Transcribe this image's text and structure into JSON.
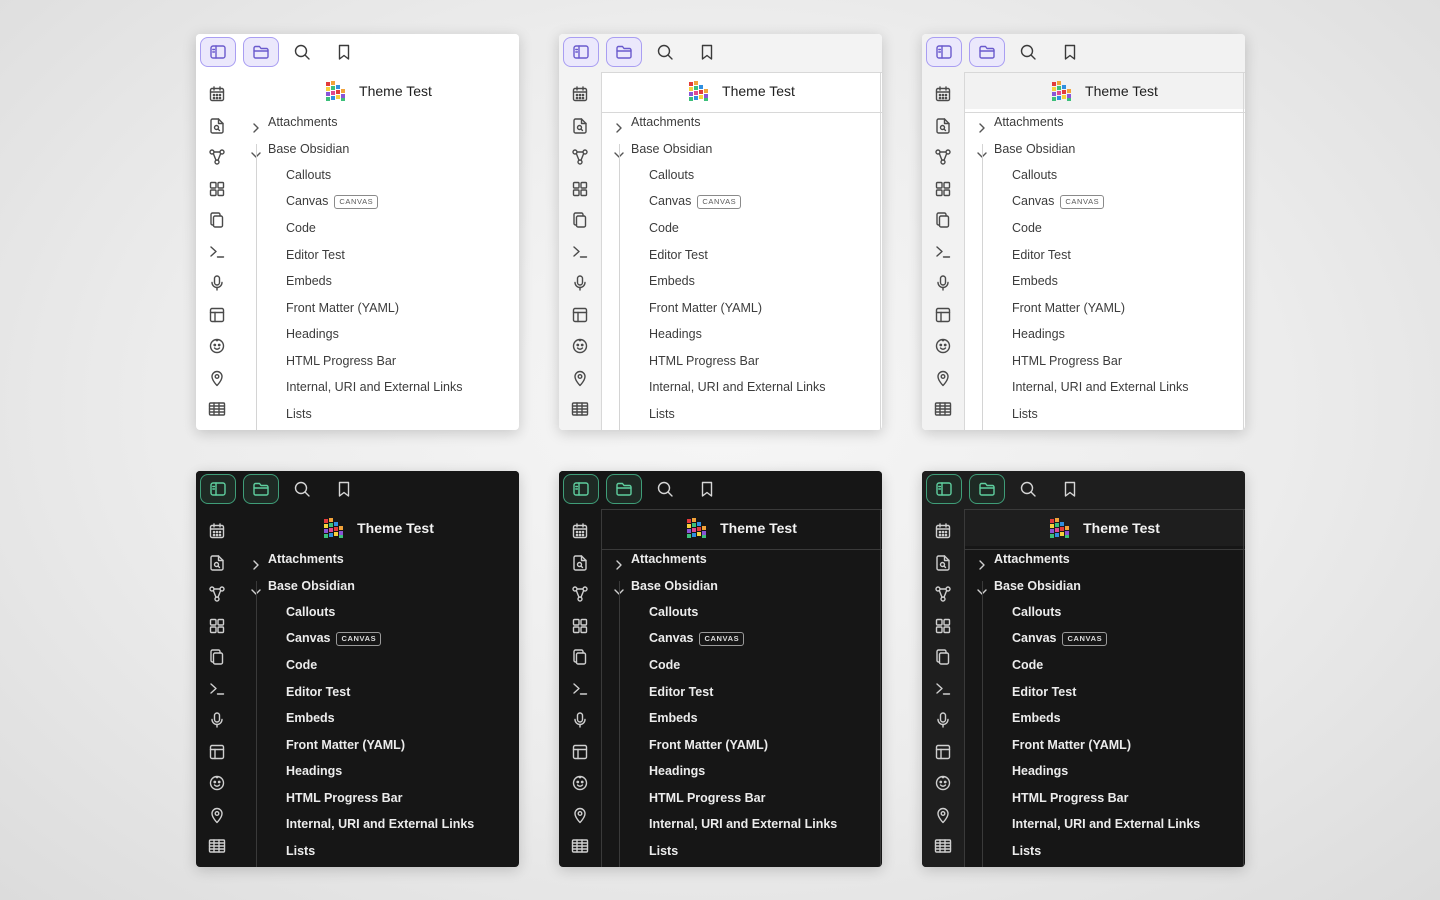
{
  "vault": {
    "name": "Theme Test"
  },
  "tree": {
    "folders": [
      {
        "label": "Attachments",
        "expanded": false
      },
      {
        "label": "Base Obsidian",
        "expanded": true
      }
    ],
    "files": [
      {
        "label": "Callouts",
        "badge": ""
      },
      {
        "label": "Canvas",
        "badge": "CANVAS"
      },
      {
        "label": "Code",
        "badge": ""
      },
      {
        "label": "Editor Test",
        "badge": ""
      },
      {
        "label": "Embeds",
        "badge": ""
      },
      {
        "label": "Front Matter (YAML)",
        "badge": ""
      },
      {
        "label": "Headings",
        "badge": ""
      },
      {
        "label": "HTML Progress Bar",
        "badge": ""
      },
      {
        "label": "Internal, URI and External Links",
        "badge": ""
      },
      {
        "label": "Lists",
        "badge": ""
      }
    ]
  },
  "toolbar_icons": [
    "sidebar-toggle-icon",
    "folder-icon",
    "search-icon",
    "bookmark-icon"
  ],
  "ribbon_icons": [
    "calendar-icon",
    "file-search-icon",
    "graph-icon",
    "dashboard-icon",
    "copy-icon",
    "terminal-icon",
    "microphone-icon",
    "layout-icon",
    "face-icon",
    "map-pin-icon",
    "table-icon"
  ],
  "colors": {
    "light_accent": "#6a5acd",
    "dark_accent": "#5fcf9f",
    "light_bg": "#ffffff",
    "dark_bg": "#161616"
  }
}
